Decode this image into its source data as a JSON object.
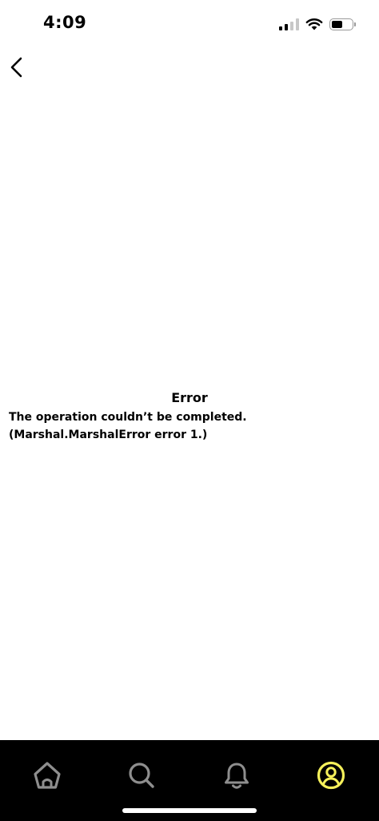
{
  "status_bar": {
    "time": "4:09",
    "icons": [
      "cellular-signal-icon",
      "wifi-icon",
      "battery-icon"
    ]
  },
  "navigation": {
    "back_icon": "chevron-left-icon"
  },
  "error": {
    "title": "Error",
    "message": "The operation couldn’t be completed. (Marshal.MarshalError error 1.)"
  },
  "tab_bar": {
    "tabs": [
      {
        "icon": "home-icon",
        "active": false
      },
      {
        "icon": "search-icon",
        "active": false
      },
      {
        "icon": "bell-icon",
        "active": false
      },
      {
        "icon": "profile-icon",
        "active": true
      }
    ],
    "colors": {
      "background": "#000000",
      "inactive": "#8e8e8e",
      "active": "#f5f05a"
    }
  }
}
